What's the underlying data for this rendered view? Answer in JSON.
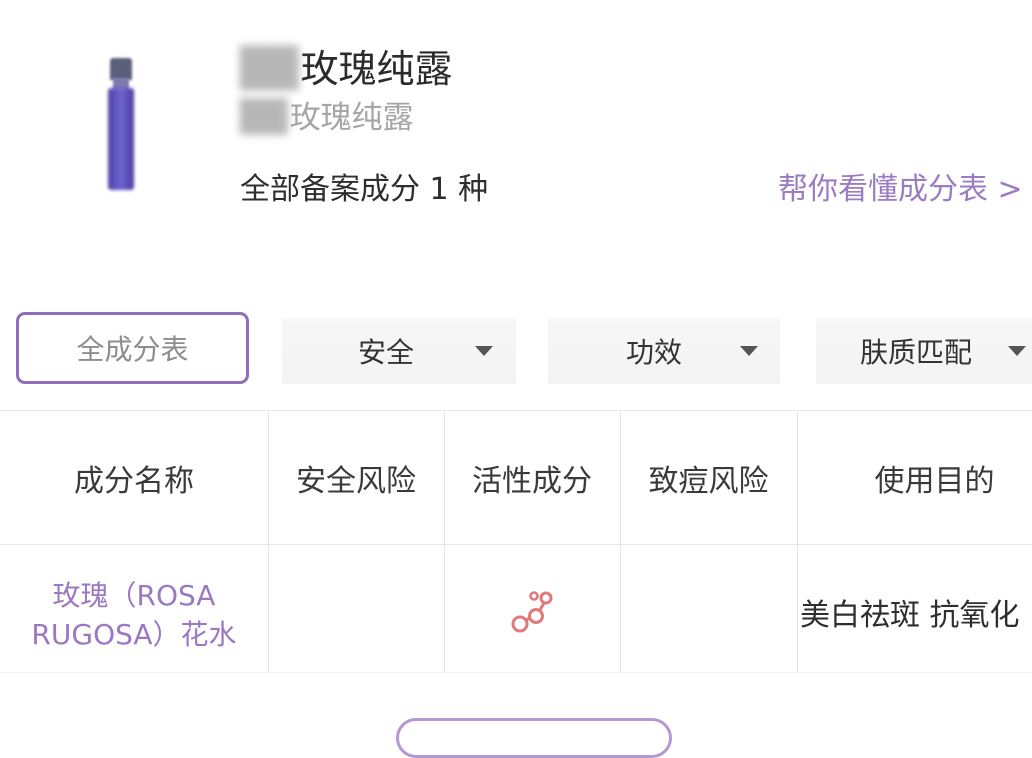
{
  "product": {
    "title": "玫瑰纯露",
    "subtitle": "玫瑰纯露",
    "ingredient_count": "全部备案成分 1 种",
    "help_link": "帮你看懂成分表 >"
  },
  "filters": {
    "all": "全成分表",
    "safety": "安全",
    "efficacy": "功效",
    "skin_match": "肤质匹配"
  },
  "table": {
    "headers": [
      "成分名称",
      "安全风险",
      "活性成分",
      "致痘风险",
      "使用目的"
    ],
    "rows": [
      {
        "name_line1": "玫瑰（ROSA",
        "name_line2": "RUGOSA）花水",
        "safety_risk": "",
        "active_icon": "active-ingredient-icon",
        "acne_risk": "",
        "purpose": "美白祛斑 抗氧化"
      }
    ]
  },
  "colors": {
    "accent": "#9b7cc3",
    "tab_border": "#8f6db8"
  }
}
